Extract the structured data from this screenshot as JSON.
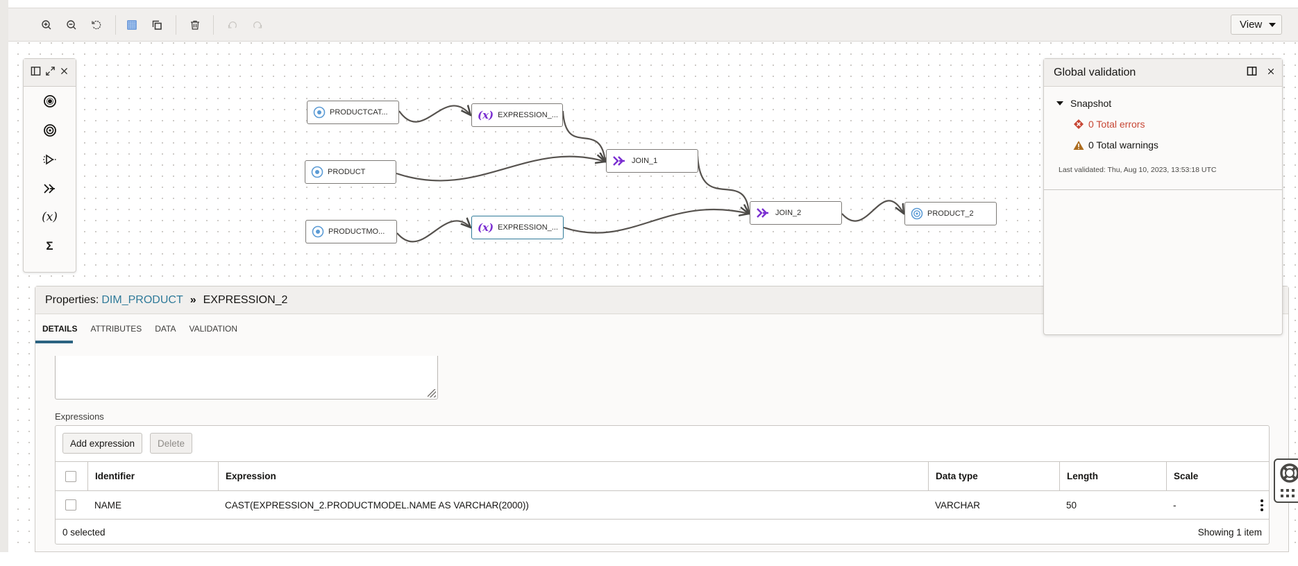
{
  "toolbar": {
    "buttons": [
      {
        "name": "zoom-in",
        "icon": "zoom-in-icon"
      },
      {
        "name": "zoom-out",
        "icon": "zoom-out-icon"
      },
      {
        "name": "reset-zoom",
        "icon": "reset-icon"
      },
      {
        "name": "grid",
        "icon": "grid-icon"
      },
      {
        "name": "duplicate",
        "icon": "copy-icon"
      },
      {
        "name": "delete",
        "icon": "trash-icon"
      },
      {
        "name": "undo",
        "icon": "undo-icon",
        "disabled": true
      },
      {
        "name": "redo",
        "icon": "redo-icon",
        "disabled": true
      }
    ],
    "view_label": "View"
  },
  "palette": {
    "items": [
      {
        "name": "source",
        "icon": "source-icon"
      },
      {
        "name": "target",
        "icon": "target-icon"
      },
      {
        "name": "filter",
        "icon": "filter-icon"
      },
      {
        "name": "join",
        "icon": "join-icon"
      },
      {
        "name": "expression",
        "icon": "expression-icon",
        "glyph": "(x)"
      },
      {
        "name": "aggregate",
        "icon": "aggregate-icon",
        "glyph": "Σ"
      }
    ]
  },
  "canvas": {
    "nodes": [
      {
        "id": "productcat",
        "label": "PRODUCTCAT...",
        "type": "source"
      },
      {
        "id": "expression1",
        "label": "EXPRESSION_...",
        "type": "expression"
      },
      {
        "id": "product",
        "label": "PRODUCT",
        "type": "source"
      },
      {
        "id": "join1",
        "label": "JOIN_1",
        "type": "join"
      },
      {
        "id": "productmo",
        "label": "PRODUCTMO...",
        "type": "source"
      },
      {
        "id": "expression2",
        "label": "EXPRESSION_...",
        "type": "expression",
        "selected": true
      },
      {
        "id": "join2",
        "label": "JOIN_2",
        "type": "join"
      },
      {
        "id": "product2",
        "label": "PRODUCT_2",
        "type": "target"
      }
    ],
    "expression_glyph": "(x)",
    "colors": {
      "source_icon": "#5b9bd5",
      "join_icon": "#7a2ed1",
      "selected_border": "#2f7a99"
    }
  },
  "global_validation": {
    "title": "Global validation",
    "section": "Snapshot",
    "errors": "0 Total errors",
    "warnings": "0 Total warnings",
    "last_validated": "Last validated: Thu, Aug 10, 2023, 13:53:18 UTC",
    "colors": {
      "error": "#c74634",
      "warning": "#ac6c1e"
    }
  },
  "properties": {
    "prefix": "Properties:",
    "parent_link": "DIM_PRODUCT",
    "separator": "»",
    "current": "EXPRESSION_2",
    "tabs": [
      {
        "label": "DETAILS",
        "active": true
      },
      {
        "label": "ATTRIBUTES"
      },
      {
        "label": "DATA"
      },
      {
        "label": "VALIDATION"
      }
    ],
    "expressions_label": "Expressions",
    "add_button": "Add expression",
    "delete_button": "Delete",
    "columns": [
      "Identifier",
      "Expression",
      "Data type",
      "Length",
      "Scale"
    ],
    "rows": [
      {
        "identifier": "NAME",
        "expression": "CAST(EXPRESSION_2.PRODUCTMODEL.NAME AS VARCHAR(2000))",
        "data_type": "VARCHAR",
        "length": "50",
        "scale": "-"
      }
    ],
    "selected_count": "0 selected",
    "showing": "Showing 1 item"
  }
}
